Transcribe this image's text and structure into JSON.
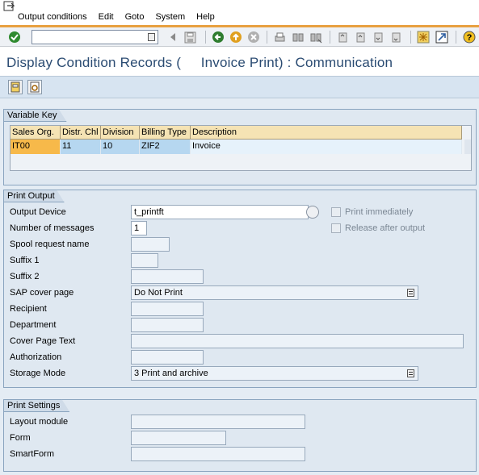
{
  "menu": {
    "items": [
      "Output conditions",
      "Edit",
      "Goto",
      "System",
      "Help"
    ]
  },
  "toolbar": {
    "command_field_value": "",
    "icons": [
      "enter-icon",
      "back-icon",
      "save-icon",
      "back-nav-icon",
      "exit-icon",
      "cancel-icon",
      "print-icon",
      "find-icon",
      "find-next-icon",
      "first-page-icon",
      "prev-page-icon",
      "next-page-icon",
      "last-page-icon",
      "create-session-icon",
      "shortcut-icon",
      "help-icon"
    ]
  },
  "title": "Display Condition Records (     Invoice Print) : Communication",
  "app_toolbar": {
    "icons": [
      "other-condition-icon",
      "details-icon"
    ]
  },
  "variable_key": {
    "title": "Variable Key",
    "columns": [
      "Sales Org.",
      "Distr. Chl",
      "Division",
      "Billing Type",
      "Description"
    ],
    "rows": [
      [
        "IT00",
        "11",
        "10",
        "ZIF2",
        "Invoice"
      ]
    ]
  },
  "print_output": {
    "title": "Print Output",
    "output_device_label": "Output Device",
    "output_device_value": "t_printft",
    "num_messages_label": "Number of messages",
    "num_messages_value": "1",
    "spool_label": "Spool request name",
    "spool_value": "",
    "suffix1_label": "Suffix 1",
    "suffix1_value": "",
    "suffix2_label": "Suffix 2",
    "suffix2_value": "",
    "cover_label": "SAP cover page",
    "cover_value": "Do Not Print",
    "recipient_label": "Recipient",
    "recipient_value": "",
    "department_label": "Department",
    "department_value": "",
    "cover_text_label": "Cover Page Text",
    "cover_text_value": "",
    "authorization_label": "Authorization",
    "authorization_value": "",
    "storage_label": "Storage Mode",
    "storage_value": "3 Print and archive",
    "print_immediately_label": "Print immediately",
    "print_immediately_checked": false,
    "release_after_label": "Release after output",
    "release_after_checked": false
  },
  "print_settings": {
    "title": "Print Settings",
    "layout_label": "Layout module",
    "layout_value": "",
    "form_label": "Form",
    "form_value": "",
    "smartform_label": "SmartForm",
    "smartform_value": ""
  },
  "colors": {
    "title_text": "#2a4b72",
    "accent_orange": "#e8a040",
    "key_cell": "#f7b94a",
    "header_cell": "#f5e3b4",
    "row_cell": "#b6d7f0"
  }
}
